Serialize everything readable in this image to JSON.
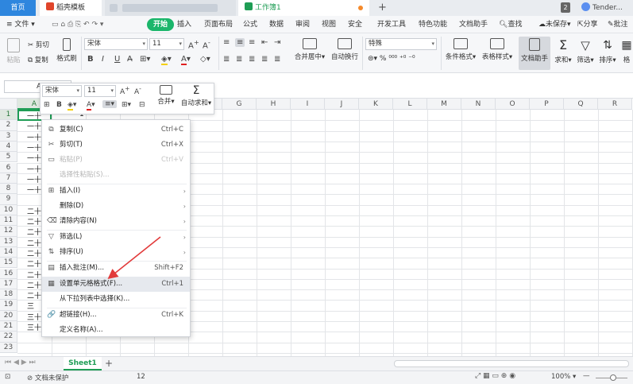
{
  "tabbar": {
    "home_label": "首页",
    "doc_label": "稻壳模板",
    "book_label": "工作簿1",
    "new_tab": "+",
    "window_count": "2",
    "user": "Tender..."
  },
  "menubar": {
    "file": "文件",
    "items": [
      "开始",
      "插入",
      "页面布局",
      "公式",
      "数据",
      "审阅",
      "视图",
      "安全",
      "开发工具",
      "特色功能",
      "文档助手"
    ],
    "search": "查找",
    "unsaved": "未保存",
    "share": "分享",
    "comment": "批注"
  },
  "ribbon": {
    "paste": "粘贴",
    "cut": "剪切",
    "copy": "复制",
    "format_painter": "格式刷",
    "font_name": "宋体",
    "font_size": "11",
    "merge_center": "合并居中",
    "auto_wrap": "自动换行",
    "number_format": "特殊",
    "cond_format": "条件格式",
    "table_style": "表格样式",
    "doc_helper": "文档助手",
    "sum": "求和",
    "filter": "筛选",
    "sort": "排序",
    "format": "格"
  },
  "minitoolbar": {
    "font_name": "宋体",
    "font_size": "11",
    "merge": "合并",
    "autosum": "自动求和"
  },
  "namebox": {
    "value": "A"
  },
  "grid": {
    "columns": [
      "A",
      "B",
      "C",
      "D",
      "E",
      "F",
      "G",
      "H",
      "I",
      "J",
      "K",
      "L",
      "M",
      "N",
      "O",
      "P",
      "Q",
      "R"
    ],
    "rows": [
      "1",
      "2",
      "3",
      "4",
      "5",
      "6",
      "7",
      "8",
      "9",
      "10",
      "11",
      "12",
      "13",
      "14",
      "15",
      "16",
      "17",
      "18",
      "19",
      "20",
      "21",
      "22",
      "23"
    ],
    "a_col_text": [
      "一十",
      "一十",
      "一十",
      "一十",
      "一十",
      "一十",
      "一十",
      "一十",
      "",
      "二十",
      "二十",
      "二十",
      "二十",
      "二十",
      "二十",
      "二十",
      "二十",
      "二十",
      "三",
      "三十",
      "三十",
      "",
      ""
    ],
    "c1_value": "1"
  },
  "context_menu": {
    "items": [
      {
        "label": "复制(C)",
        "shortcut": "Ctrl+C",
        "icon": "copy-icon",
        "glyph": "⧉"
      },
      {
        "label": "剪切(T)",
        "shortcut": "Ctrl+X",
        "icon": "scissors-icon",
        "glyph": "✂"
      },
      {
        "label": "粘贴(P)",
        "shortcut": "Ctrl+V",
        "icon": "paste-icon",
        "glyph": "▭"
      },
      {
        "label": "选择性粘贴(S)...",
        "shortcut": "",
        "icon": "paste-special-icon",
        "glyph": ""
      },
      {
        "label": "插入(I)",
        "shortcut": "",
        "icon": "insert-icon",
        "glyph": "⊞"
      },
      {
        "label": "删除(D)",
        "shortcut": "",
        "icon": "delete-icon",
        "glyph": ""
      },
      {
        "label": "清除内容(N)",
        "shortcut": "",
        "icon": "clear-icon",
        "glyph": "⌫"
      },
      {
        "label": "筛选(L)",
        "shortcut": "",
        "icon": "filter-icon",
        "glyph": "▽"
      },
      {
        "label": "排序(U)",
        "shortcut": "",
        "icon": "sort-icon",
        "glyph": "⇅"
      },
      {
        "label": "插入批注(M)...",
        "shortcut": "Shift+F2",
        "icon": "comment-icon",
        "glyph": "▤"
      },
      {
        "label": "设置单元格格式(F)...",
        "shortcut": "Ctrl+1",
        "icon": "format-cells-icon",
        "glyph": "▦"
      },
      {
        "label": "从下拉列表中选择(K)...",
        "shortcut": "",
        "icon": "dropdown-list-icon",
        "glyph": ""
      },
      {
        "label": "超链接(H)...",
        "shortcut": "Ctrl+K",
        "icon": "link-icon",
        "glyph": "🔗"
      },
      {
        "label": "定义名称(A)...",
        "shortcut": "",
        "icon": "define-name-icon",
        "glyph": ""
      }
    ]
  },
  "sheetbar": {
    "sheet1": "Sheet1",
    "add": "+"
  },
  "statusbar": {
    "doc_status": "文档未保护",
    "count_value": "12",
    "zoom": "100%"
  },
  "colors": {
    "accent_green": "#1f9d55",
    "start_tab_green": "#1bb66b",
    "home_blue": "#2e86de",
    "arrow_red": "#e23b3b"
  }
}
